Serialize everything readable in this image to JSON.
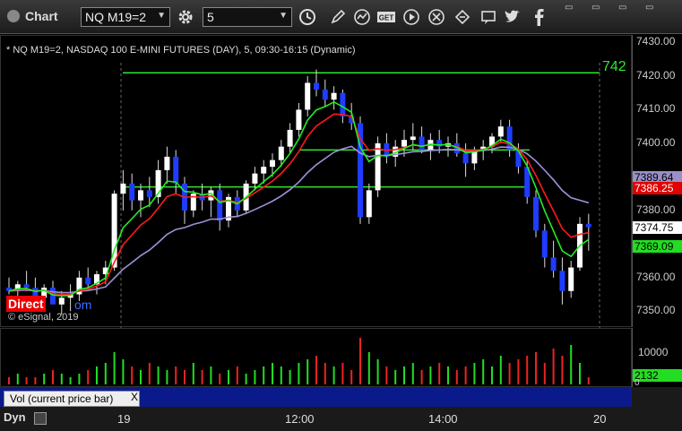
{
  "toolbar": {
    "title": "Chart",
    "symbol": "NQ M19=2",
    "interval": "5",
    "icons": [
      "settings-icon",
      "clock-icon",
      "pencil-icon",
      "chart-icon",
      "get-icon",
      "play-icon",
      "alert-icon",
      "link-icon",
      "comment-icon",
      "twitter-icon",
      "facebook-icon"
    ]
  },
  "chart": {
    "header": "* NQ M19=2, NASDAQ 100 E-MINI FUTURES (DAY), 5, 09:30-16:15 (Dynamic)",
    "brand_text": "Direct",
    "brand_tail": "om",
    "copyright": "© eSignal, 2019",
    "line_value": "742",
    "price_ticks": [
      "7430.00",
      "7420.00",
      "7410.00",
      "7400.00",
      "7380.00",
      "7360.00",
      "7350.00"
    ],
    "price_tags": [
      {
        "label": "7389.64",
        "bg": "#9a8fc8",
        "fg": "#000"
      },
      {
        "label": "7386.25",
        "bg": "#e00000",
        "fg": "#fff"
      },
      {
        "label": "7374.75",
        "bg": "#ffffff",
        "fg": "#000"
      },
      {
        "label": "7369.09",
        "bg": "#22dd22",
        "fg": "#000"
      }
    ]
  },
  "volume": {
    "title": "Vol (current price bar)",
    "close": "X",
    "ticks": [
      "10000",
      "0"
    ],
    "tag": "2132"
  },
  "time_axis": {
    "mode": "Dyn",
    "labels": [
      "19",
      "12:00",
      "14:00",
      "20"
    ]
  },
  "chart_data": {
    "type": "candlestick",
    "ylim": [
      7345,
      7432
    ],
    "candles": [
      [
        7357,
        7360,
        7355,
        7356
      ],
      [
        7356,
        7359,
        7353,
        7358
      ],
      [
        7358,
        7362,
        7356,
        7357
      ],
      [
        7357,
        7360,
        7352,
        7354
      ],
      [
        7354,
        7358,
        7351,
        7357
      ],
      [
        7357,
        7359,
        7353,
        7352
      ],
      [
        7352,
        7356,
        7349,
        7354
      ],
      [
        7354,
        7358,
        7350,
        7355
      ],
      [
        7355,
        7362,
        7353,
        7360
      ],
      [
        7360,
        7363,
        7356,
        7358
      ],
      [
        7358,
        7362,
        7355,
        7361
      ],
      [
        7361,
        7365,
        7358,
        7363
      ],
      [
        7363,
        7386,
        7362,
        7385
      ],
      [
        7385,
        7392,
        7380,
        7388
      ],
      [
        7388,
        7391,
        7380,
        7383
      ],
      [
        7383,
        7388,
        7378,
        7386
      ],
      [
        7386,
        7390,
        7381,
        7384
      ],
      [
        7384,
        7395,
        7382,
        7392
      ],
      [
        7392,
        7399,
        7388,
        7396
      ],
      [
        7396,
        7398,
        7385,
        7388
      ],
      [
        7388,
        7390,
        7376,
        7380
      ],
      [
        7380,
        7386,
        7378,
        7385
      ],
      [
        7385,
        7388,
        7380,
        7383
      ],
      [
        7383,
        7387,
        7378,
        7386
      ],
      [
        7386,
        7388,
        7374,
        7377
      ],
      [
        7377,
        7385,
        7375,
        7384
      ],
      [
        7384,
        7386,
        7378,
        7380
      ],
      [
        7380,
        7389,
        7379,
        7388
      ],
      [
        7388,
        7393,
        7386,
        7391
      ],
      [
        7391,
        7395,
        7388,
        7393
      ],
      [
        7393,
        7397,
        7390,
        7395
      ],
      [
        7395,
        7401,
        7393,
        7399
      ],
      [
        7399,
        7406,
        7397,
        7404
      ],
      [
        7404,
        7412,
        7402,
        7410
      ],
      [
        7410,
        7420,
        7408,
        7418
      ],
      [
        7418,
        7422,
        7414,
        7416
      ],
      [
        7416,
        7419,
        7411,
        7413
      ],
      [
        7413,
        7417,
        7410,
        7415
      ],
      [
        7415,
        7416,
        7406,
        7408
      ],
      [
        7408,
        7412,
        7404,
        7406
      ],
      [
        7406,
        7408,
        7376,
        7378
      ],
      [
        7378,
        7388,
        7376,
        7386
      ],
      [
        7386,
        7402,
        7384,
        7400
      ],
      [
        7400,
        7403,
        7394,
        7396
      ],
      [
        7396,
        7401,
        7393,
        7399
      ],
      [
        7399,
        7404,
        7396,
        7401
      ],
      [
        7401,
        7406,
        7398,
        7402
      ],
      [
        7402,
        7405,
        7397,
        7398
      ],
      [
        7398,
        7403,
        7395,
        7401
      ],
      [
        7401,
        7404,
        7397,
        7399
      ],
      [
        7399,
        7402,
        7396,
        7400
      ],
      [
        7400,
        7403,
        7396,
        7397
      ],
      [
        7397,
        7400,
        7390,
        7394
      ],
      [
        7394,
        7399,
        7392,
        7398
      ],
      [
        7398,
        7401,
        7395,
        7399
      ],
      [
        7399,
        7403,
        7397,
        7402
      ],
      [
        7402,
        7407,
        7400,
        7405
      ],
      [
        7405,
        7407,
        7396,
        7398
      ],
      [
        7398,
        7400,
        7391,
        7393
      ],
      [
        7393,
        7395,
        7382,
        7384
      ],
      [
        7384,
        7386,
        7372,
        7374
      ],
      [
        7374,
        7376,
        7363,
        7366
      ],
      [
        7366,
        7371,
        7360,
        7362
      ],
      [
        7362,
        7366,
        7352,
        7356
      ],
      [
        7356,
        7365,
        7354,
        7363
      ],
      [
        7363,
        7378,
        7362,
        7376
      ],
      [
        7376,
        7379,
        7368,
        7375
      ]
    ],
    "lines": [
      {
        "name": "green_upper",
        "color": "#2ee82e",
        "y": 7421
      },
      {
        "name": "green_mid",
        "color": "#2ee82e",
        "y": 7398
      },
      {
        "name": "green_lower",
        "color": "#2ee82e",
        "y": 7387
      }
    ],
    "volume": [
      2,
      3,
      2,
      2,
      3,
      4,
      3,
      2,
      3,
      4,
      5,
      6,
      9,
      7,
      5,
      4,
      6,
      5,
      4,
      5,
      4,
      6,
      4,
      5,
      3,
      4,
      5,
      3,
      4,
      5,
      6,
      5,
      4,
      6,
      7,
      8,
      6,
      5,
      6,
      4,
      13,
      9,
      7,
      5,
      4,
      5,
      6,
      4,
      5,
      6,
      5,
      4,
      5,
      6,
      7,
      5,
      8,
      6,
      7,
      8,
      9,
      6,
      10,
      8,
      11,
      6,
      2
    ]
  }
}
